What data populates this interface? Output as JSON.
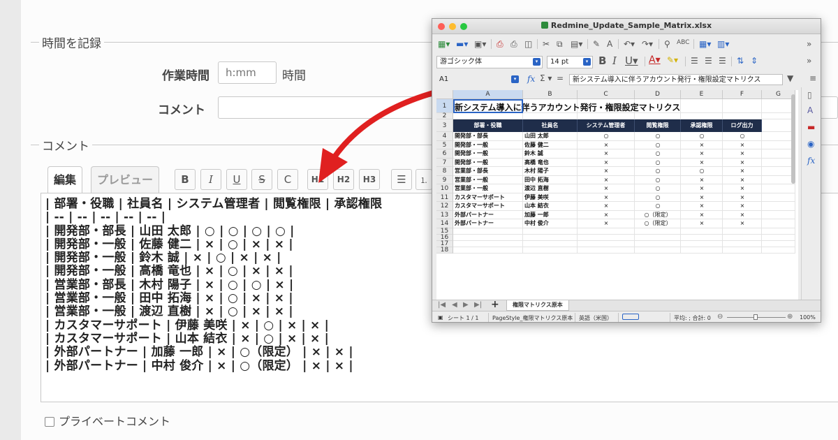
{
  "form": {
    "time_legend": "時間を記録",
    "hours_label": "作業時間",
    "hours_placeholder": "h:mm",
    "hours_unit": "時間",
    "comment_field_label": "コメント",
    "comment_legend": "コメント",
    "tab_edit": "編集",
    "tab_preview": "プレビュー",
    "toolbar": [
      "B",
      "I",
      "U",
      "S",
      "C",
      "H1",
      "H2",
      "H3"
    ],
    "editor_lines": [
      "| 部署・役職 | 社員名 | システム管理者 | 閲覧権限 | 承認権限",
      "| -- | -- | -- | -- | -- |",
      "| 開発部・部長 | 山田 太郎 | ○ | ○ | ○ | ○ |",
      "| 開発部・一般 | 佐藤 健二 | × | ○ | × | × |",
      "| 開発部・一般 | 鈴木 誠 | × | ○ | × | × |",
      "| 開発部・一般 | 高橋 竜也 | × | ○ | × | × |",
      "| 営業部・部長 | 木村 陽子 | × | ○ | ○ | × |",
      "| 営業部・一般 | 田中 拓海 | × | ○ | × | × |",
      "| 営業部・一般 | 渡辺 直樹 | × | ○ | × | × |",
      "| カスタマーサポート | 伊藤 美咲 | × | ○ | × | × |",
      "| カスタマーサポート | 山本 結衣 | × | ○ | × | × |",
      "| 外部パートナー | 加藤 一郎 | × | ○（限定） | × | × |",
      "| 外部パートナー | 中村 俊介 | × | ○（限定） | × | × |"
    ],
    "private_label": "プライベートコメント"
  },
  "spreadsheet": {
    "window_title": "Redmine_Update_Sample_Matrix.xlsx",
    "font_name": "游ゴシック体",
    "font_size": "14 pt",
    "cell_ref": "A1",
    "formula": "新システム導入に伴うアカウント発行・権限設定マトリクス",
    "columns": [
      "A",
      "B",
      "C",
      "D",
      "E",
      "F",
      "G"
    ],
    "title": "新システム導入に伴うアカウント発行・権限設定マトリクス",
    "header": [
      "部署・役職",
      "社員名",
      "システム管理者",
      "閲覧権限",
      "承認権限",
      "ログ出力"
    ],
    "rows": [
      [
        "開発部・部長",
        "山田 太郎",
        "○",
        "○",
        "○",
        "○"
      ],
      [
        "開発部・一般",
        "佐藤 健二",
        "×",
        "○",
        "×",
        "×"
      ],
      [
        "開発部・一般",
        "鈴木 誠",
        "×",
        "○",
        "×",
        "×"
      ],
      [
        "開発部・一般",
        "高橋 竜也",
        "×",
        "○",
        "×",
        "×"
      ],
      [
        "営業部・部長",
        "木村 陽子",
        "×",
        "○",
        "○",
        "×"
      ],
      [
        "営業部・一般",
        "田中 拓海",
        "×",
        "○",
        "×",
        "×"
      ],
      [
        "営業部・一般",
        "渡辺 直樹",
        "×",
        "○",
        "×",
        "×"
      ],
      [
        "カスタマーサポート",
        "伊藤 美咲",
        "×",
        "○",
        "×",
        "×"
      ],
      [
        "カスタマーサポート",
        "山本 結衣",
        "×",
        "○",
        "×",
        "×"
      ],
      [
        "外部パートナー",
        "加藤 一郎",
        "×",
        "○（限定）",
        "×",
        "×"
      ],
      [
        "外部パートナー",
        "中村 俊介",
        "×",
        "○（限定）",
        "×",
        "×"
      ]
    ],
    "row_numbers": [
      "1",
      "2",
      "3",
      "4",
      "5",
      "6",
      "7",
      "8",
      "9",
      "10",
      "11",
      "12",
      "13",
      "14",
      "15",
      "16",
      "17",
      "18"
    ],
    "sheet_tab": "権限マトリクス原本",
    "status": {
      "sheet": "シート 1 / 1",
      "page_style": "PageStyle_権限マトリクス原本",
      "language": "英語（米国）",
      "sum": "平均: ; 合計: 0",
      "zoom": "100%"
    }
  },
  "colors": {
    "arrow": "#e02020",
    "header_fill": "#1f2d4a",
    "accent": "#2a64c5"
  }
}
